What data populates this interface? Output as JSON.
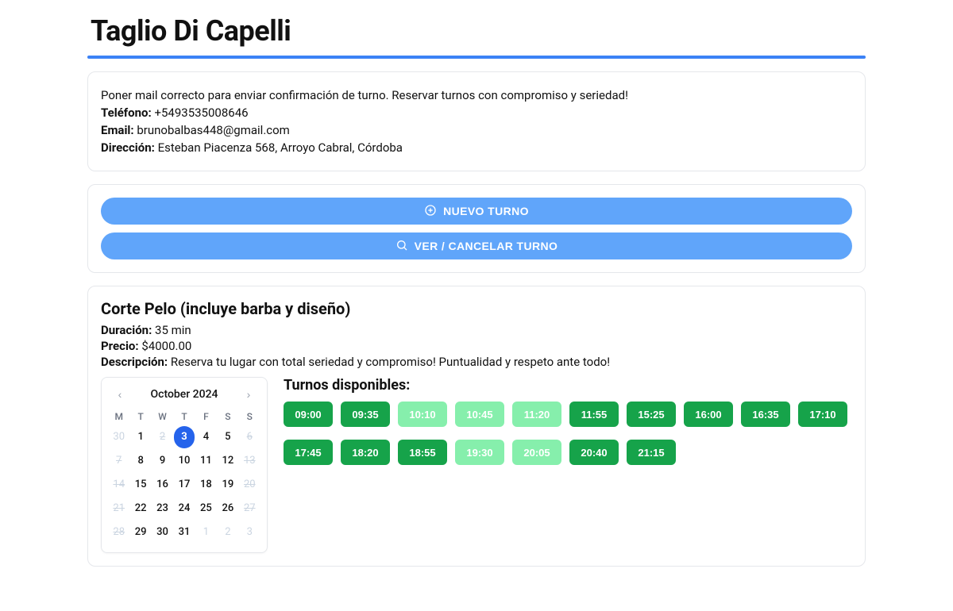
{
  "title": "Taglio Di Capelli",
  "info": {
    "notice": "Poner mail correcto para enviar confirmación de turno. Reservar turnos con compromiso y seriedad!",
    "phone_label": "Teléfono:",
    "phone_value": "+5493535008646",
    "email_label": "Email:",
    "email_value": "brunobalbas448@gmail.com",
    "address_label": "Dirección:",
    "address_value": "Esteban Piacenza 568, Arroyo Cabral, Córdoba"
  },
  "actions": {
    "new_label": "NUEVO TURNO",
    "view_cancel_label": "VER / CANCELAR TURNO"
  },
  "service": {
    "title": "Corte Pelo (incluye barba y diseño)",
    "duration_label": "Duración:",
    "duration_value": "35 min",
    "price_label": "Precio:",
    "price_value": "$4000.00",
    "desc_label": "Descripción:",
    "desc_value": "Reserva tu lugar con total seriedad y compromiso! Puntualidad y respeto ante todo!"
  },
  "calendar": {
    "month_label": "October 2024",
    "dow": [
      "M",
      "T",
      "W",
      "T",
      "F",
      "S",
      "S"
    ],
    "cells": [
      {
        "t": "30",
        "muted": true
      },
      {
        "t": "1"
      },
      {
        "t": "2",
        "strike": true
      },
      {
        "t": "3",
        "selected": true
      },
      {
        "t": "4"
      },
      {
        "t": "5"
      },
      {
        "t": "6",
        "strike": true
      },
      {
        "t": "7",
        "strike": true
      },
      {
        "t": "8"
      },
      {
        "t": "9"
      },
      {
        "t": "10"
      },
      {
        "t": "11"
      },
      {
        "t": "12"
      },
      {
        "t": "13",
        "strike": true
      },
      {
        "t": "14",
        "strike": true
      },
      {
        "t": "15"
      },
      {
        "t": "16"
      },
      {
        "t": "17"
      },
      {
        "t": "18"
      },
      {
        "t": "19"
      },
      {
        "t": "20",
        "strike": true
      },
      {
        "t": "21",
        "strike": true
      },
      {
        "t": "22"
      },
      {
        "t": "23"
      },
      {
        "t": "24"
      },
      {
        "t": "25"
      },
      {
        "t": "26"
      },
      {
        "t": "27",
        "strike": true
      },
      {
        "t": "28",
        "strike": true
      },
      {
        "t": "29"
      },
      {
        "t": "30"
      },
      {
        "t": "31"
      },
      {
        "t": "1",
        "muted": true
      },
      {
        "t": "2",
        "muted": true
      },
      {
        "t": "3",
        "muted": true
      }
    ]
  },
  "slots": {
    "title": "Turnos disponibles:",
    "items": [
      {
        "t": "09:00",
        "available": true
      },
      {
        "t": "09:35",
        "available": true
      },
      {
        "t": "10:10",
        "available": false
      },
      {
        "t": "10:45",
        "available": false
      },
      {
        "t": "11:20",
        "available": false
      },
      {
        "t": "11:55",
        "available": true
      },
      {
        "t": "15:25",
        "available": true
      },
      {
        "t": "16:00",
        "available": true
      },
      {
        "t": "16:35",
        "available": true
      },
      {
        "t": "17:10",
        "available": true
      },
      {
        "t": "17:45",
        "available": true
      },
      {
        "t": "18:20",
        "available": true
      },
      {
        "t": "18:55",
        "available": true
      },
      {
        "t": "19:30",
        "available": false
      },
      {
        "t": "20:05",
        "available": false
      },
      {
        "t": "20:40",
        "available": true
      },
      {
        "t": "21:15",
        "available": true
      }
    ]
  }
}
